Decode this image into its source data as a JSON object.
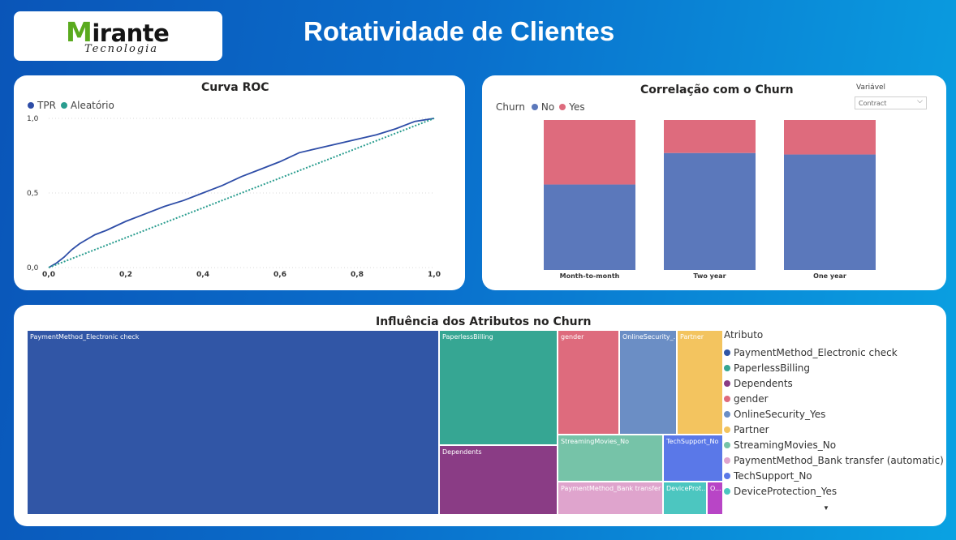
{
  "header": {
    "title": "Rotatividade de Clientes",
    "logo_word": "irante",
    "logo_initial": "M",
    "logo_sub": "Tecnologia"
  },
  "roc": {
    "title": "Curva ROC",
    "legend": [
      {
        "name": "TPR",
        "color": "#2e4da7"
      },
      {
        "name": "Aleatório",
        "color": "#2a9d8f"
      }
    ]
  },
  "churn": {
    "title": "Correlação com o Churn",
    "legend_title": "Churn",
    "legend": [
      {
        "name": "No",
        "color": "#5b78bb"
      },
      {
        "name": "Yes",
        "color": "#de6b7d"
      }
    ],
    "slicer_label": "Variável",
    "slicer_value": "Contract"
  },
  "treemap": {
    "title": "Influência dos Atributos no Churn",
    "legend_title": "Atributo",
    "more_indicator": "▼"
  },
  "chart_data": [
    {
      "type": "line",
      "title": "Curva ROC",
      "xlim": [
        0,
        1
      ],
      "ylim": [
        0,
        1
      ],
      "x_ticks": [
        "0,0",
        "0,2",
        "0,4",
        "0,6",
        "0,8",
        "1,0"
      ],
      "y_ticks": [
        "0,0",
        "0,5",
        "1,0"
      ],
      "grid": true,
      "legend_position": "top-left",
      "series": [
        {
          "name": "TPR",
          "color": "#2e4da7",
          "x": [
            0,
            0.02,
            0.04,
            0.06,
            0.08,
            0.1,
            0.12,
            0.15,
            0.2,
            0.25,
            0.3,
            0.35,
            0.4,
            0.45,
            0.5,
            0.55,
            0.6,
            0.65,
            0.7,
            0.75,
            0.8,
            0.85,
            0.9,
            0.95,
            1.0
          ],
          "y": [
            0,
            0.03,
            0.07,
            0.12,
            0.16,
            0.19,
            0.22,
            0.25,
            0.31,
            0.36,
            0.41,
            0.45,
            0.5,
            0.55,
            0.61,
            0.66,
            0.71,
            0.77,
            0.8,
            0.83,
            0.86,
            0.89,
            0.93,
            0.98,
            1.0
          ]
        },
        {
          "name": "Aleatório",
          "color": "#2a9d8f",
          "dashed": true,
          "x": [
            0,
            1
          ],
          "y": [
            0,
            1
          ]
        }
      ]
    },
    {
      "type": "bar",
      "stacked": "100%",
      "title": "Correlação com o Churn",
      "categories": [
        "Month-to-month",
        "Two year",
        "One year"
      ],
      "series": [
        {
          "name": "No",
          "color": "#5b78bb",
          "values": [
            0.57,
            0.78,
            0.77
          ]
        },
        {
          "name": "Yes",
          "color": "#de6b7d",
          "values": [
            0.43,
            0.22,
            0.23
          ]
        }
      ],
      "legend_position": "top-left"
    },
    {
      "type": "treemap",
      "title": "Influência dos Atributos no Churn",
      "legend_position": "right",
      "items": [
        {
          "name": "PaymentMethod_Electronic check",
          "label": "PaymentMethod_Electronic check",
          "value": 115000,
          "color": "#3156a6"
        },
        {
          "name": "PaperlessBilling",
          "label": "PaperlessBilling",
          "value": 19000,
          "color": "#36a693"
        },
        {
          "name": "Dependents",
          "label": "Dependents",
          "value": 12700,
          "color": "#8a3c85"
        },
        {
          "name": "gender",
          "label": "gender",
          "value": 9700,
          "color": "#de6b7d"
        },
        {
          "name": "OnlineSecurity_Yes",
          "label": "OnlineSecurity_...",
          "value": 9400,
          "color": "#6b8ec5"
        },
        {
          "name": "Partner",
          "label": "Partner",
          "value": 7700,
          "color": "#f3c45f"
        },
        {
          "name": "StreamingMovies_No",
          "label": "StreamingMovies_No",
          "value": 7400,
          "color": "#76c3a8"
        },
        {
          "name": "PaymentMethod_Bank transfer (automatic)",
          "label": "PaymentMethod_Bank transfer (...",
          "value": 5000,
          "color": "#dfa4cd"
        },
        {
          "name": "TechSupport_No",
          "label": "TechSupport_No",
          "value": 3800,
          "color": "#5a78e8"
        },
        {
          "name": "DeviceProtection_Yes",
          "label": "DeviceProt...",
          "value": 2100,
          "color": "#4cc6c0"
        },
        {
          "name": "O",
          "label": "O...",
          "value": 830,
          "color": "#b845c6"
        }
      ]
    }
  ]
}
